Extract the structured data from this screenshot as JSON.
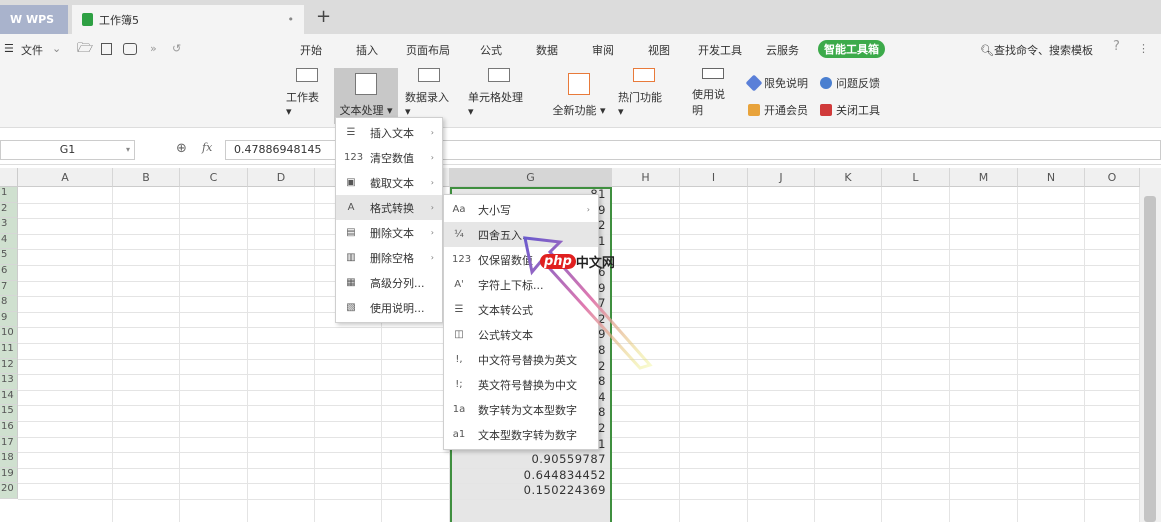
{
  "tabs": {
    "wps": "W WPS",
    "doc": "工作簿5",
    "close": "•",
    "new": "+"
  },
  "menubar": {
    "file": "文件",
    "file_arrow": "⌄",
    "more": "»",
    "undo": "↺",
    "items": [
      "开始",
      "插入",
      "页面布局",
      "公式",
      "数据",
      "审阅",
      "视图",
      "开发工具",
      "云服务",
      "智能工具箱"
    ],
    "search": "查找命令、搜索模板",
    "help": "?",
    "kebab": "⋮"
  },
  "ribbon": {
    "big": [
      {
        "label": "工作表 ▾"
      },
      {
        "label": "文本处理 ▾"
      },
      {
        "label": "数据录入 ▾"
      },
      {
        "label": "单元格处理 ▾"
      },
      {
        "label": "全新功能 ▾"
      },
      {
        "label": "热门功能 ▾"
      },
      {
        "label": "使用说明"
      }
    ],
    "small": [
      "限免说明",
      "问题反馈",
      "开通会员",
      "关闭工具"
    ]
  },
  "formula": {
    "cell": "G1",
    "fx": "fx",
    "value": "0.47886948145"
  },
  "columns": [
    "A",
    "B",
    "C",
    "D",
    "E",
    "F",
    "G",
    "H",
    "I",
    "J",
    "K",
    "L",
    "M",
    "N",
    "O"
  ],
  "rows": [
    "1",
    "2",
    "3",
    "4",
    "5",
    "6",
    "7",
    "8",
    "9",
    "10",
    "11",
    "12",
    "13",
    "14",
    "15",
    "16",
    "17",
    "18",
    "19",
    "20"
  ],
  "g_values": [
    "81",
    "99",
    "52",
    "41",
    "",
    "16",
    "39",
    "37",
    "02",
    "59",
    "38",
    "92",
    "08",
    "34",
    "48",
    "0.590994092",
    "0.536274021",
    "0.90559787",
    "0.644834452",
    "0.150224369"
  ],
  "menu1": [
    {
      "icon": "☰",
      "label": "插入文本",
      "sub": true
    },
    {
      "icon": "123",
      "label": "清空数值",
      "sub": true
    },
    {
      "icon": "▣",
      "label": "截取文本",
      "sub": true
    },
    {
      "icon": "A",
      "label": "格式转换",
      "sub": true
    },
    {
      "icon": "▤",
      "label": "删除文本",
      "sub": true
    },
    {
      "icon": "▥",
      "label": "删除空格",
      "sub": true
    },
    {
      "icon": "▦",
      "label": "高级分列...",
      "sub": false
    },
    {
      "icon": "▧",
      "label": "使用说明...",
      "sub": false
    }
  ],
  "menu2": [
    {
      "icon": "Aa",
      "label": "大小写",
      "sub": true
    },
    {
      "icon": "¼",
      "label": "四舍五入...",
      "sub": false
    },
    {
      "icon": "123",
      "label": "仅保留数值",
      "sub": false
    },
    {
      "icon": "A'",
      "label": "字符上下标...",
      "sub": false
    },
    {
      "icon": "☰",
      "label": "文本转公式",
      "sub": false
    },
    {
      "icon": "◫",
      "label": "公式转文本",
      "sub": false
    },
    {
      "icon": "!,",
      "label": "中文符号替换为英文",
      "sub": false
    },
    {
      "icon": "!;",
      "label": "英文符号替换为中文",
      "sub": false
    },
    {
      "icon": "1a",
      "label": "数字转为文本型数字",
      "sub": false
    },
    {
      "icon": "a1",
      "label": "文本型数字转为数字",
      "sub": false
    }
  ],
  "submenu_arrow": "›",
  "watermark": "php中文网"
}
